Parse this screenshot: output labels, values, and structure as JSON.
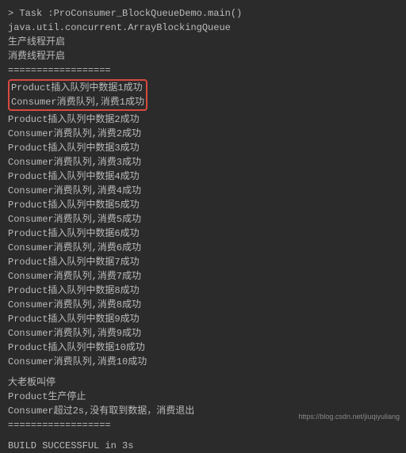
{
  "header": {
    "task_line": "> Task :ProConsumer_BlockQueueDemo.main()",
    "class_line": "java.util.concurrent.ArrayBlockingQueue",
    "producer_start": "生产线程开启",
    "consumer_start": "消费线程开启",
    "divider": "=================="
  },
  "highlighted": [
    "Product插入队列中数据1成功",
    "Consumer消费队列,消费1成功"
  ],
  "output_lines": [
    "Product插入队列中数据2成功",
    "Consumer消费队列,消费2成功",
    "Product插入队列中数据3成功",
    "Consumer消费队列,消费3成功",
    "Product插入队列中数据4成功",
    "Consumer消费队列,消费4成功",
    "Product插入队列中数据5成功",
    "Consumer消费队列,消费5成功",
    "Product插入队列中数据6成功",
    "Consumer消费队列,消费6成功",
    "Product插入队列中数据7成功",
    "Consumer消费队列,消费7成功",
    "Product插入队列中数据8成功",
    "Consumer消费队列,消费8成功",
    "Product插入队列中数据9成功",
    "Consumer消费队列,消费9成功",
    "Product插入队列中数据10成功",
    "Consumer消费队列,消费10成功"
  ],
  "footer": {
    "boss_stop": "大老板叫停",
    "product_stop": "Product生产停止",
    "consumer_timeout": "Consumer超过2s,没有取到数据，消费退出",
    "divider": "==================",
    "build_result": "BUILD SUCCESSFUL in 3s"
  },
  "watermark": "https://blog.csdn.net/jiuqiyuliang"
}
